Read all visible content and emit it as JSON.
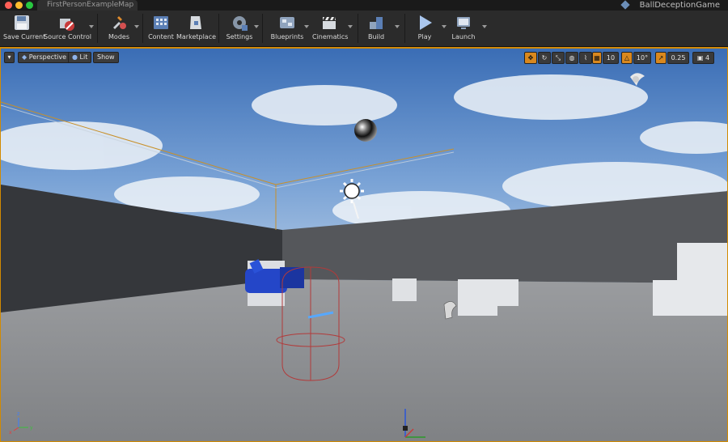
{
  "window": {
    "tab_title": "FirstPersonExampleMap",
    "project_name": "BallDeceptionGame"
  },
  "toolbar": {
    "save_current": "Save Current",
    "source_control": "Source Control",
    "modes": "Modes",
    "content": "Content",
    "marketplace": "Marketplace",
    "settings": "Settings",
    "blueprints": "Blueprints",
    "cinematics": "Cinematics",
    "build": "Build",
    "play": "Play",
    "launch": "Launch"
  },
  "viewport": {
    "perspective": "Perspective",
    "lit": "Lit",
    "show": "Show",
    "grid_snap": "10",
    "rotation_snap": "10°",
    "scale_snap": "0.25",
    "camera_speed": "4"
  },
  "colors": {
    "accent": "#d28a00",
    "toolbar_bg": "#2b2b2b",
    "sky_top": "#3a6db5",
    "floor": "#8d8f92",
    "wall": "#4a4c50"
  }
}
